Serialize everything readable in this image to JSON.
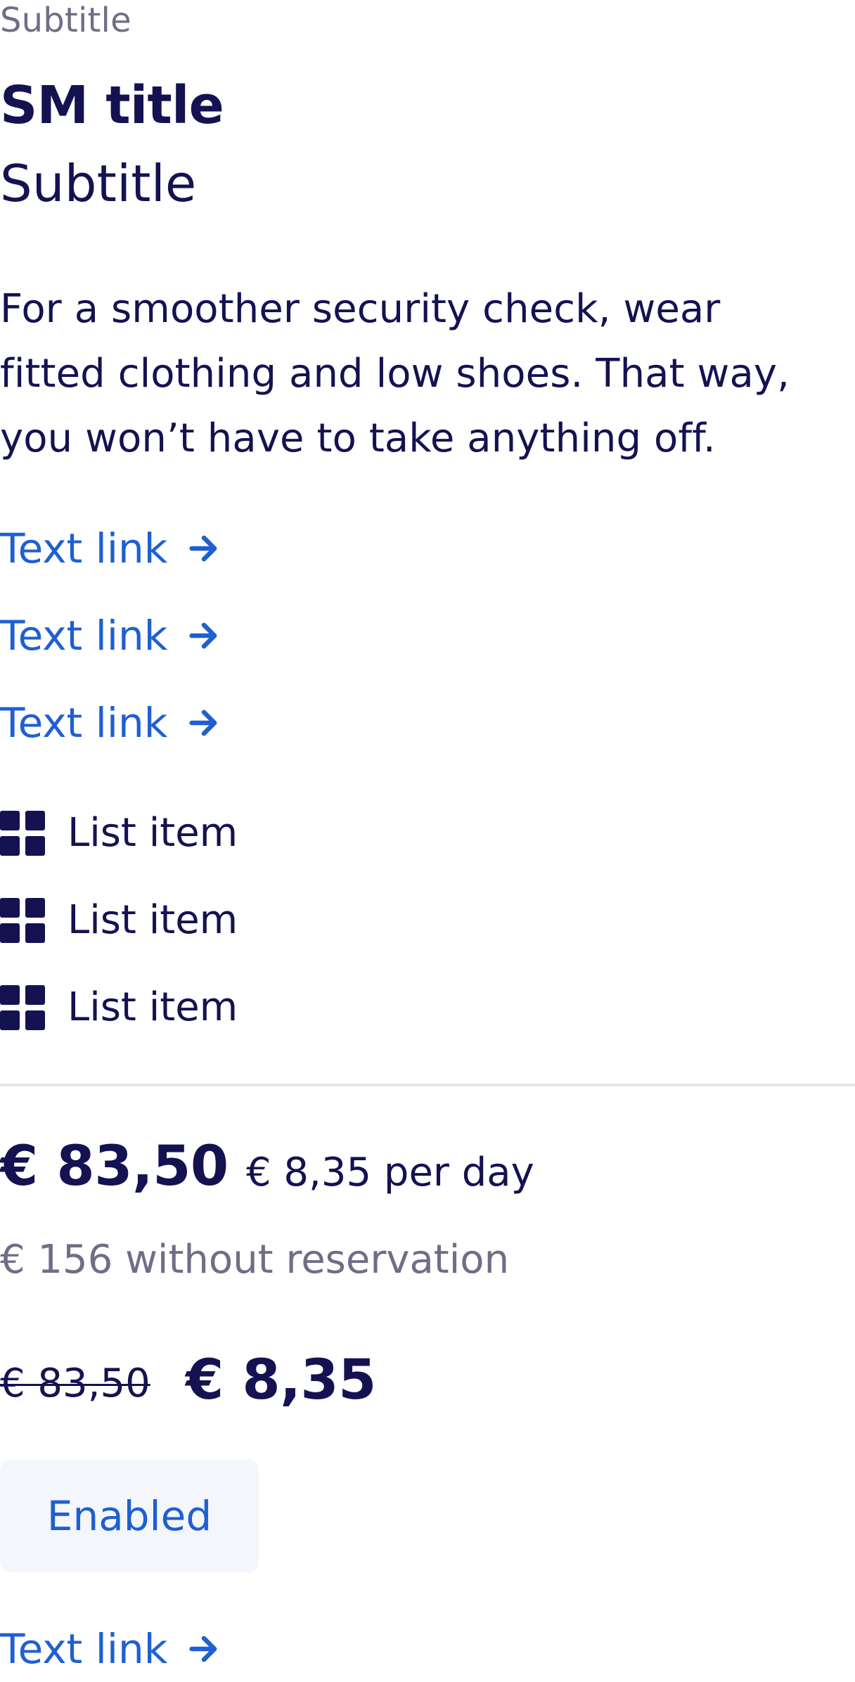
{
  "header": {
    "eyebrow": "Subtitle",
    "title": "SM title",
    "subtitle": "Subtitle"
  },
  "body": {
    "text": "For a smoother security check, wear fitted clothing and low shoes. That way, you won’t have to take anything off."
  },
  "links": [
    {
      "label": "Text link",
      "icon": "arrow-right-icon"
    },
    {
      "label": "Text link",
      "icon": "arrow-right-icon"
    },
    {
      "label": "Text link",
      "icon": "arrow-right-icon"
    }
  ],
  "list": [
    {
      "label": "List item",
      "icon": "grid-icon"
    },
    {
      "label": "List item",
      "icon": "grid-icon"
    },
    {
      "label": "List item",
      "icon": "grid-icon"
    }
  ],
  "pricing": {
    "current": "€ 83,50",
    "per_day": "€ 8,35 per day",
    "without_reservation": "€ 156 without reservation",
    "old_price": "€ 83,50",
    "new_price": "€ 8,35"
  },
  "button": {
    "label": "Enabled"
  },
  "bottom_link": {
    "label": "Text link",
    "icon": "arrow-right-icon"
  },
  "colors": {
    "text": "#141251",
    "muted": "#6f6e86",
    "link": "#1f5fd1",
    "button_bg": "#f3f6fb",
    "divider": "#e5e5ea"
  }
}
